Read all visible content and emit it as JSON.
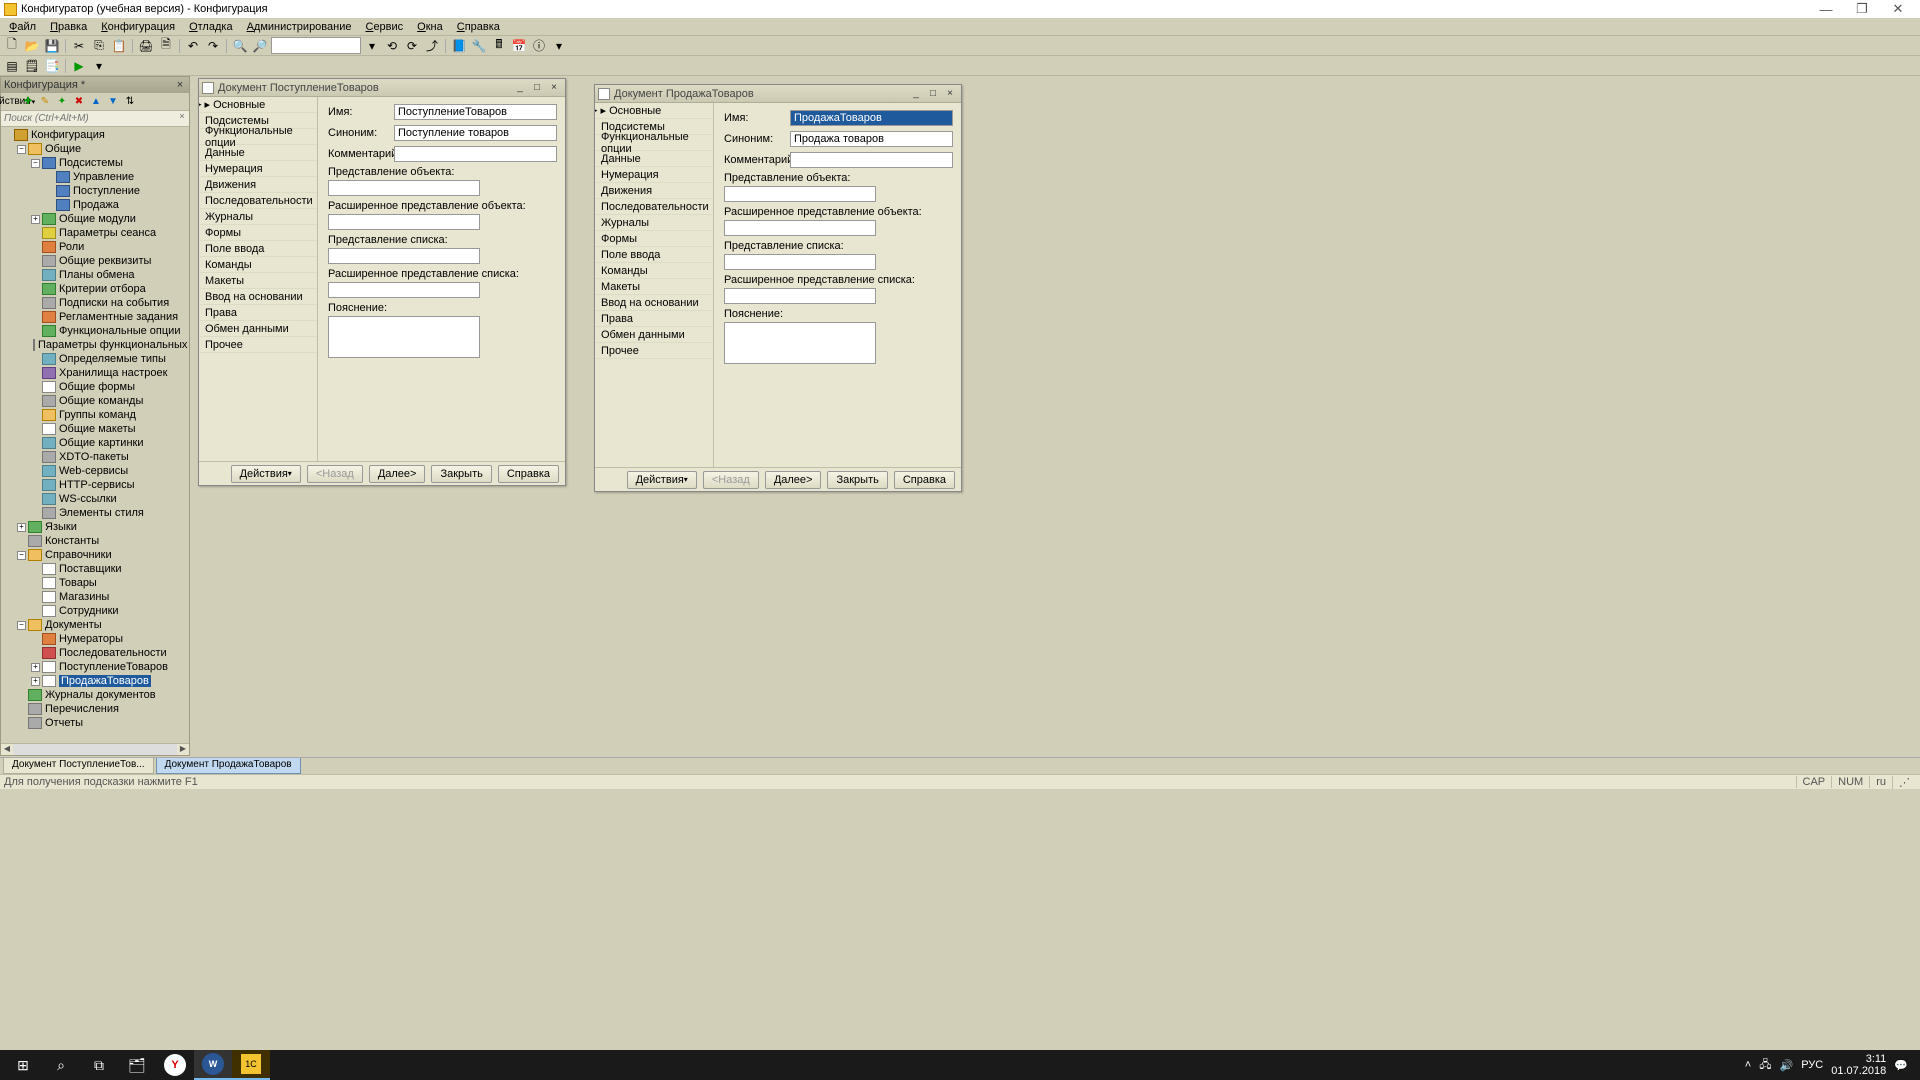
{
  "app": {
    "title": "Конфигуратор (учебная версия) - Конфигурация"
  },
  "menu": {
    "items": [
      "Файл",
      "Правка",
      "Конфигурация",
      "Отладка",
      "Администрирование",
      "Сервис",
      "Окна",
      "Справка"
    ]
  },
  "panel": {
    "title": "Конфигурация *",
    "actions_label": "Действия",
    "search_placeholder": "Поиск (Ctrl+Alt+M)"
  },
  "tree": {
    "root": "Конфигурация",
    "nodes": [
      {
        "d": 1,
        "e": "-",
        "i": "folder",
        "l": "Общие"
      },
      {
        "d": 2,
        "e": "-",
        "i": "blue",
        "l": "Подсистемы"
      },
      {
        "d": 3,
        "e": "",
        "i": "blue",
        "l": "Управление"
      },
      {
        "d": 3,
        "e": "",
        "i": "blue",
        "l": "Поступление"
      },
      {
        "d": 3,
        "e": "",
        "i": "blue",
        "l": "Продажа"
      },
      {
        "d": 2,
        "e": "+",
        "i": "green",
        "l": "Общие модули"
      },
      {
        "d": 2,
        "e": "",
        "i": "yellow",
        "l": "Параметры сеанса"
      },
      {
        "d": 2,
        "e": "",
        "i": "orange",
        "l": "Роли"
      },
      {
        "d": 2,
        "e": "",
        "i": "gray",
        "l": "Общие реквизиты"
      },
      {
        "d": 2,
        "e": "",
        "i": "cyan",
        "l": "Планы обмена"
      },
      {
        "d": 2,
        "e": "",
        "i": "green",
        "l": "Критерии отбора"
      },
      {
        "d": 2,
        "e": "",
        "i": "gray",
        "l": "Подписки на события"
      },
      {
        "d": 2,
        "e": "",
        "i": "orange",
        "l": "Регламентные задания"
      },
      {
        "d": 2,
        "e": "",
        "i": "green",
        "l": "Функциональные опции"
      },
      {
        "d": 2,
        "e": "",
        "i": "gray",
        "l": "Параметры функциональных опц"
      },
      {
        "d": 2,
        "e": "",
        "i": "cyan",
        "l": "Определяемые типы"
      },
      {
        "d": 2,
        "e": "",
        "i": "purple",
        "l": "Хранилища настроек"
      },
      {
        "d": 2,
        "e": "",
        "i": "doc",
        "l": "Общие формы"
      },
      {
        "d": 2,
        "e": "",
        "i": "gray",
        "l": "Общие команды"
      },
      {
        "d": 2,
        "e": "",
        "i": "folder",
        "l": "Группы команд"
      },
      {
        "d": 2,
        "e": "",
        "i": "doc",
        "l": "Общие макеты"
      },
      {
        "d": 2,
        "e": "",
        "i": "cyan",
        "l": "Общие картинки"
      },
      {
        "d": 2,
        "e": "",
        "i": "gray",
        "l": "XDTO-пакеты"
      },
      {
        "d": 2,
        "e": "",
        "i": "cyan",
        "l": "Web-сервисы"
      },
      {
        "d": 2,
        "e": "",
        "i": "cyan",
        "l": "HTTP-сервисы"
      },
      {
        "d": 2,
        "e": "",
        "i": "cyan",
        "l": "WS-ссылки"
      },
      {
        "d": 2,
        "e": "",
        "i": "gray",
        "l": "Элементы стиля"
      },
      {
        "d": 1,
        "e": "+",
        "i": "green",
        "l": "Языки"
      },
      {
        "d": 1,
        "e": "",
        "i": "gray",
        "l": "Константы"
      },
      {
        "d": 1,
        "e": "-",
        "i": "folder",
        "l": "Справочники"
      },
      {
        "d": 2,
        "e": "",
        "i": "doc",
        "l": "Поставщики"
      },
      {
        "d": 2,
        "e": "",
        "i": "doc",
        "l": "Товары"
      },
      {
        "d": 2,
        "e": "",
        "i": "doc",
        "l": "Магазины"
      },
      {
        "d": 2,
        "e": "",
        "i": "doc",
        "l": "Сотрудники"
      },
      {
        "d": 1,
        "e": "-",
        "i": "folder",
        "l": "Документы"
      },
      {
        "d": 2,
        "e": "",
        "i": "orange",
        "l": "Нумераторы"
      },
      {
        "d": 2,
        "e": "",
        "i": "red",
        "l": "Последовательности"
      },
      {
        "d": 2,
        "e": "+",
        "i": "doc",
        "l": "ПоступлениеТоваров"
      },
      {
        "d": 2,
        "e": "+",
        "i": "doc",
        "l": "ПродажаТоваров",
        "sel": true
      },
      {
        "d": 1,
        "e": "",
        "i": "green",
        "l": "Журналы документов"
      },
      {
        "d": 1,
        "e": "",
        "i": "gray",
        "l": "Перечисления"
      },
      {
        "d": 1,
        "e": "",
        "i": "gray",
        "l": "Отчеты"
      }
    ]
  },
  "docnav": [
    "Основные",
    "Подсистемы",
    "Функциональные опции",
    "Данные",
    "Нумерация",
    "Движения",
    "Последовательности",
    "Журналы",
    "Формы",
    "Поле ввода",
    "Команды",
    "Макеты",
    "Ввод на основании",
    "Права",
    "Обмен данными",
    "Прочее"
  ],
  "formlabels": {
    "name": "Имя:",
    "synonym": "Синоним:",
    "comment": "Комментарий:",
    "objrep": "Представление объекта:",
    "extobjrep": "Расширенное представление объекта:",
    "listrep": "Представление списка:",
    "extlistrep": "Расширенное представление списка:",
    "explain": "Пояснение:"
  },
  "buttons": {
    "actions": "Действия",
    "back": "<Назад",
    "next": "Далее>",
    "close": "Закрыть",
    "help": "Справка"
  },
  "doc1": {
    "title": "Документ ПоступлениеТоваров",
    "name": "ПоступлениеТоваров",
    "synonym": "Поступление товаров"
  },
  "doc2": {
    "title": "Документ ПродажаТоваров",
    "name": "ПродажаТоваров",
    "synonym": "Продажа товаров"
  },
  "bottom_tabs": [
    "Документ ПоступлениеТов...",
    "Документ ПродажаТоваров"
  ],
  "status": {
    "hint": "Для получения подсказки нажмите F1",
    "cap": "CAP",
    "num": "NUM",
    "lang": "ru"
  },
  "tray": {
    "ime": "РУС",
    "time": "3:11",
    "date": "01.07.2018"
  }
}
